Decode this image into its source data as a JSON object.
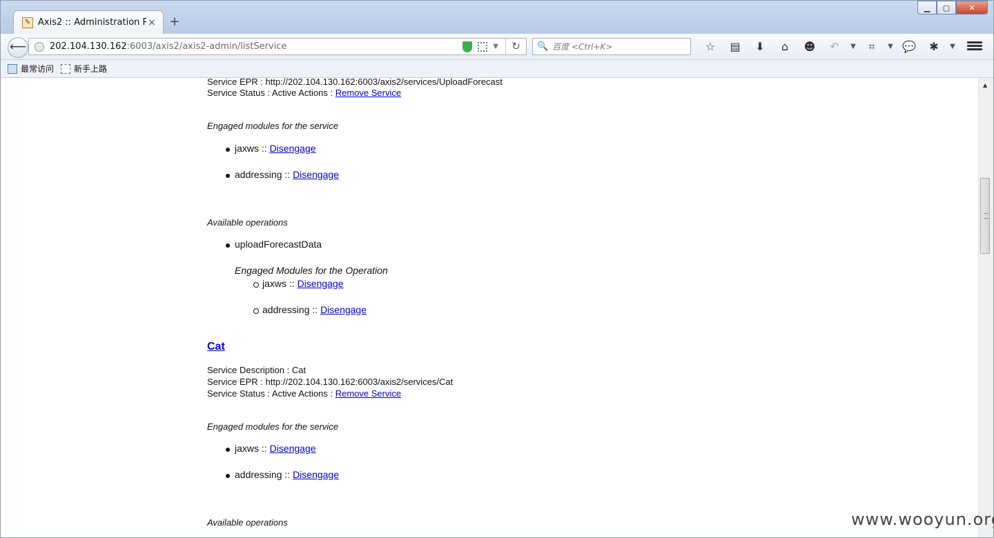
{
  "browser": {
    "tab_title": "Axis2 :: Administration P...",
    "tab_close": "×",
    "new_tab": "+",
    "url_host": "202.104.130.162",
    "url_path": ":6003/axis2/axis2-admin/listService",
    "search_placeholder": "百度 <Ctrl+K>",
    "bookmarks": [
      "最常访问",
      "新手上路"
    ]
  },
  "page": {
    "upload_epr": "Service EPR : http://202.104.130.162:6003/axis2/services/UploadForecast",
    "upload_status_prefix": "Service Status : Active Actions : ",
    "remove_service": "Remove Service",
    "engaged_modules_service": "Engaged modules for the service",
    "module_jaxws": "jaxws",
    "module_addressing": "addressing",
    "separator": " :: ",
    "disengage": "Disengage",
    "available_operations": "Available operations",
    "operation_upload": "uploadForecastData",
    "engaged_modules_operation": "Engaged Modules for the Operation",
    "cat_name": "Cat",
    "cat_description": "Service Description : Cat",
    "cat_epr": "Service EPR : http://202.104.130.162:6003/axis2/services/Cat",
    "cat_status_prefix": "Service Status : Active Actions : "
  },
  "watermark": "www.wooyun.org"
}
